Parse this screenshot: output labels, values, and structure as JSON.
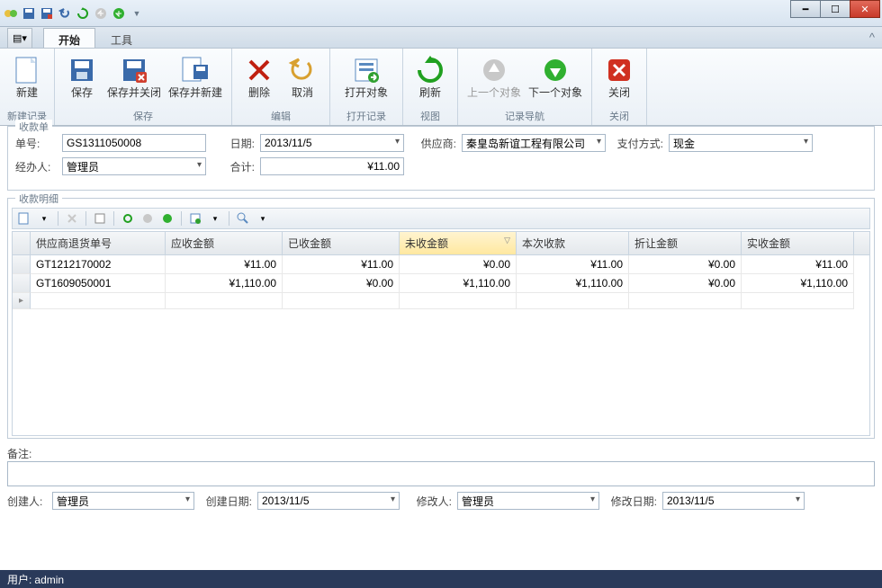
{
  "window": {
    "minimize": "━",
    "maximize": "☐",
    "close": "✕"
  },
  "tabs": {
    "menu": "▦",
    "start": "开始",
    "tools": "工具"
  },
  "ribbon": {
    "new": "新建",
    "save": "保存",
    "saveClose": "保存并关闭",
    "saveNew": "保存并新建",
    "delete": "删除",
    "cancel": "取消",
    "open": "打开对象",
    "refresh": "刷新",
    "prev": "上一个对象",
    "next": "下一个对象",
    "close": "关闭",
    "groups": {
      "newRec": "新建记录",
      "save": "保存",
      "edit": "编辑",
      "openRec": "打开记录",
      "view": "视图",
      "nav": "记录导航",
      "close": "关闭"
    }
  },
  "form": {
    "legend": "收款单",
    "billNo_lbl": "单号:",
    "billNo": "GS1311050008",
    "date_lbl": "日期:",
    "date": "2013/11/5",
    "supplier_lbl": "供应商:",
    "supplier": "秦皇岛新谊工程有限公司",
    "payType_lbl": "支付方式:",
    "payType": "现金",
    "handler_lbl": "经办人:",
    "handler": "管理员",
    "total_lbl": "合计:",
    "total": "¥11.00"
  },
  "detail": {
    "legend": "收款明细",
    "cols": {
      "returnNo": "供应商退货单号",
      "due": "应收金额",
      "received": "已收金额",
      "unreceived": "未收金额",
      "thisPay": "本次收款",
      "discount": "折让金额",
      "actual": "实收金额"
    },
    "rows": [
      {
        "returnNo": "GT1212170002",
        "due": "¥11.00",
        "received": "¥11.00",
        "unreceived": "¥0.00",
        "thisPay": "¥11.00",
        "discount": "¥0.00",
        "actual": "¥11.00"
      },
      {
        "returnNo": "GT1609050001",
        "due": "¥1,110.00",
        "received": "¥0.00",
        "unreceived": "¥1,110.00",
        "thisPay": "¥1,110.00",
        "discount": "¥0.00",
        "actual": "¥1,110.00"
      }
    ]
  },
  "remark_lbl": "备注:",
  "audit": {
    "creator_lbl": "创建人:",
    "creator": "管理员",
    "createDate_lbl": "创建日期:",
    "createDate": "2013/11/5",
    "modifier_lbl": "修改人:",
    "modifier": "管理员",
    "modifyDate_lbl": "修改日期:",
    "modifyDate": "2013/11/5"
  },
  "status": {
    "user_lbl": "用户:",
    "user": "admin"
  }
}
